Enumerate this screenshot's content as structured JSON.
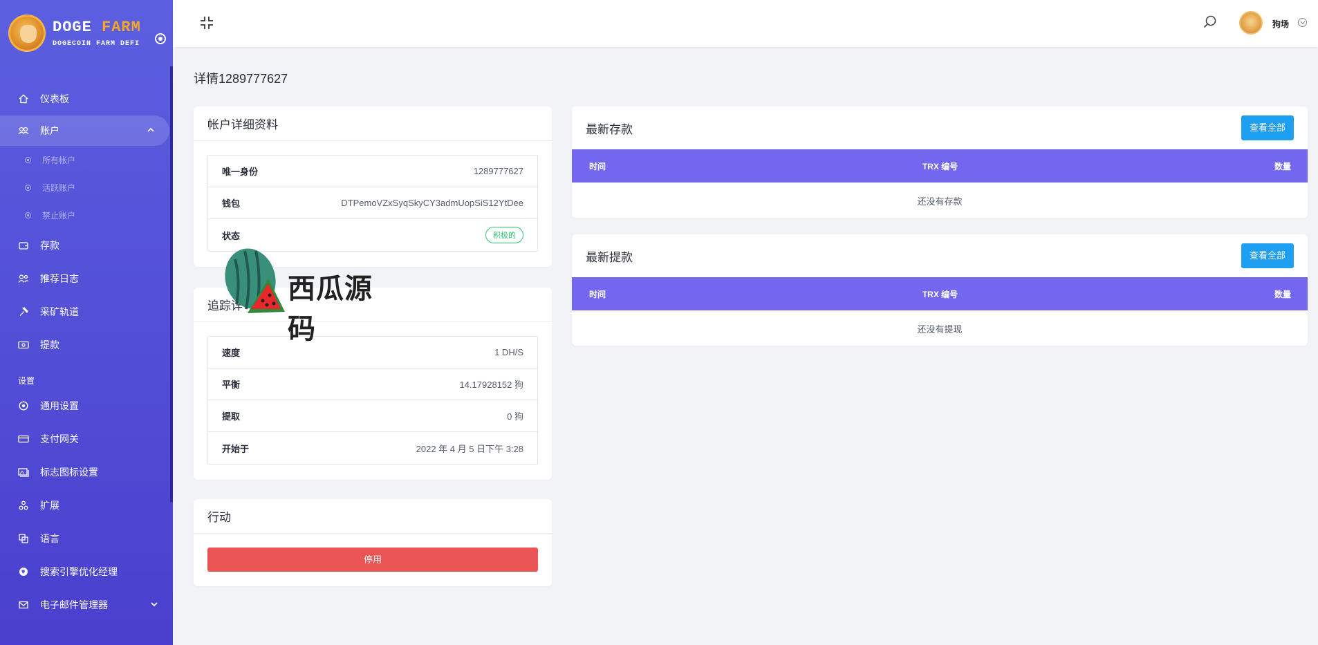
{
  "brand": {
    "name_left": "DOGE",
    "name_right": "FARM",
    "subtitle": "DOGECOIN FARM DEFI"
  },
  "sidebar": {
    "items": [
      {
        "label": "仪表板",
        "icon": "home-icon"
      },
      {
        "label": "账户",
        "icon": "users-icon",
        "active": true,
        "expanded": true
      },
      {
        "label": "存款",
        "icon": "wallet-icon"
      },
      {
        "label": "推荐日志",
        "icon": "referral-icon"
      },
      {
        "label": "采矿轨道",
        "icon": "hammer-icon"
      },
      {
        "label": "提款",
        "icon": "withdraw-icon"
      }
    ],
    "sub_items": [
      {
        "label": "所有帐户"
      },
      {
        "label": "活跃账户"
      },
      {
        "label": "禁止账户"
      }
    ],
    "section_label": "设置",
    "settings_items": [
      {
        "label": "通用设置",
        "icon": "settings-icon"
      },
      {
        "label": "支付网关",
        "icon": "credit-card-icon"
      },
      {
        "label": "标志图标设置",
        "icon": "image-icon"
      },
      {
        "label": "扩展",
        "icon": "extension-icon"
      },
      {
        "label": "语言",
        "icon": "language-icon"
      },
      {
        "label": "搜索引擎优化经理",
        "icon": "globe-icon"
      },
      {
        "label": "电子邮件管理器",
        "icon": "mail-icon"
      }
    ]
  },
  "header": {
    "username": "狗场"
  },
  "page": {
    "title": "详情1289777627"
  },
  "account_card": {
    "title": "帐户详细资料",
    "rows": [
      {
        "label": "唯一身份",
        "value": "1289777627"
      },
      {
        "label": "钱包",
        "value": "DTPemoVZxSyqSkyCY3admUopSiS12YtDee"
      },
      {
        "label": "状态",
        "value": "积极的"
      }
    ]
  },
  "tracking_card": {
    "title": "追踪详",
    "rows": [
      {
        "label": "速度",
        "value": "1 DH/S"
      },
      {
        "label": "平衡",
        "value": "14.17928152 狗"
      },
      {
        "label": "提取",
        "value": "0 狗"
      },
      {
        "label": "开始于",
        "value": "2022 年 4 月 5 日下午 3:28"
      }
    ]
  },
  "action_card": {
    "title": "行动",
    "disable_label": "停用"
  },
  "deposits": {
    "title": "最新存款",
    "view_all": "查看全部",
    "columns": [
      "时间",
      "TRX 编号",
      "数量"
    ],
    "empty_text": "还没有存款"
  },
  "withdrawals": {
    "title": "最新提款",
    "view_all": "查看全部",
    "columns": [
      "时间",
      "TRX 编号",
      "数量"
    ],
    "empty_text": "还没有提现"
  },
  "watermark": {
    "text": "西瓜源码"
  },
  "colors": {
    "sidebar": "#5254d9",
    "table_header": "#7367f0",
    "button_info": "#1e9ff2",
    "button_danger": "#ea5455",
    "badge_success": "#28c76f",
    "brand_accent": "#f5a623"
  }
}
